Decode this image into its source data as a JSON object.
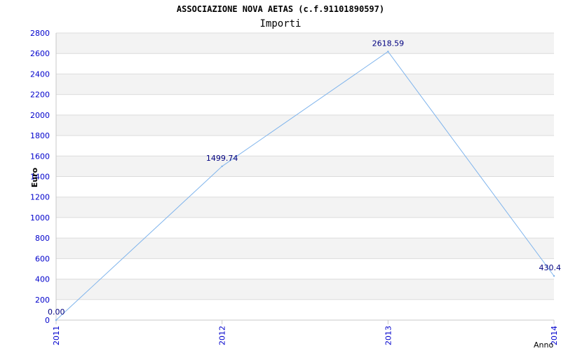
{
  "chart_data": {
    "type": "line",
    "title": "ASSOCIAZIONE NOVA AETAS (c.f.91101890597)",
    "subtitle": "Importi",
    "xlabel": "Anno",
    "ylabel": "Euro",
    "categories": [
      "2011",
      "2012",
      "2013",
      "2014"
    ],
    "values": [
      0.0,
      1499.74,
      2618.59,
      430.4
    ],
    "data_labels": [
      "0.00",
      "1499.74",
      "2618.59",
      "430.4"
    ],
    "ylim": [
      0,
      2800
    ],
    "yticks": [
      0,
      200,
      400,
      600,
      800,
      1000,
      1200,
      1400,
      1600,
      1800,
      2000,
      2200,
      2400,
      2600,
      2800
    ],
    "grid": true,
    "legend": "none"
  },
  "colors": {
    "line": "#7fb4ec",
    "tick_text": "#0000cc",
    "label_text": "#000080",
    "title_text": "#000000",
    "band_light": "#f3f3f3",
    "band_white": "#ffffff",
    "gridline": "#dcdcdc",
    "axis": "#c8c8c8"
  }
}
